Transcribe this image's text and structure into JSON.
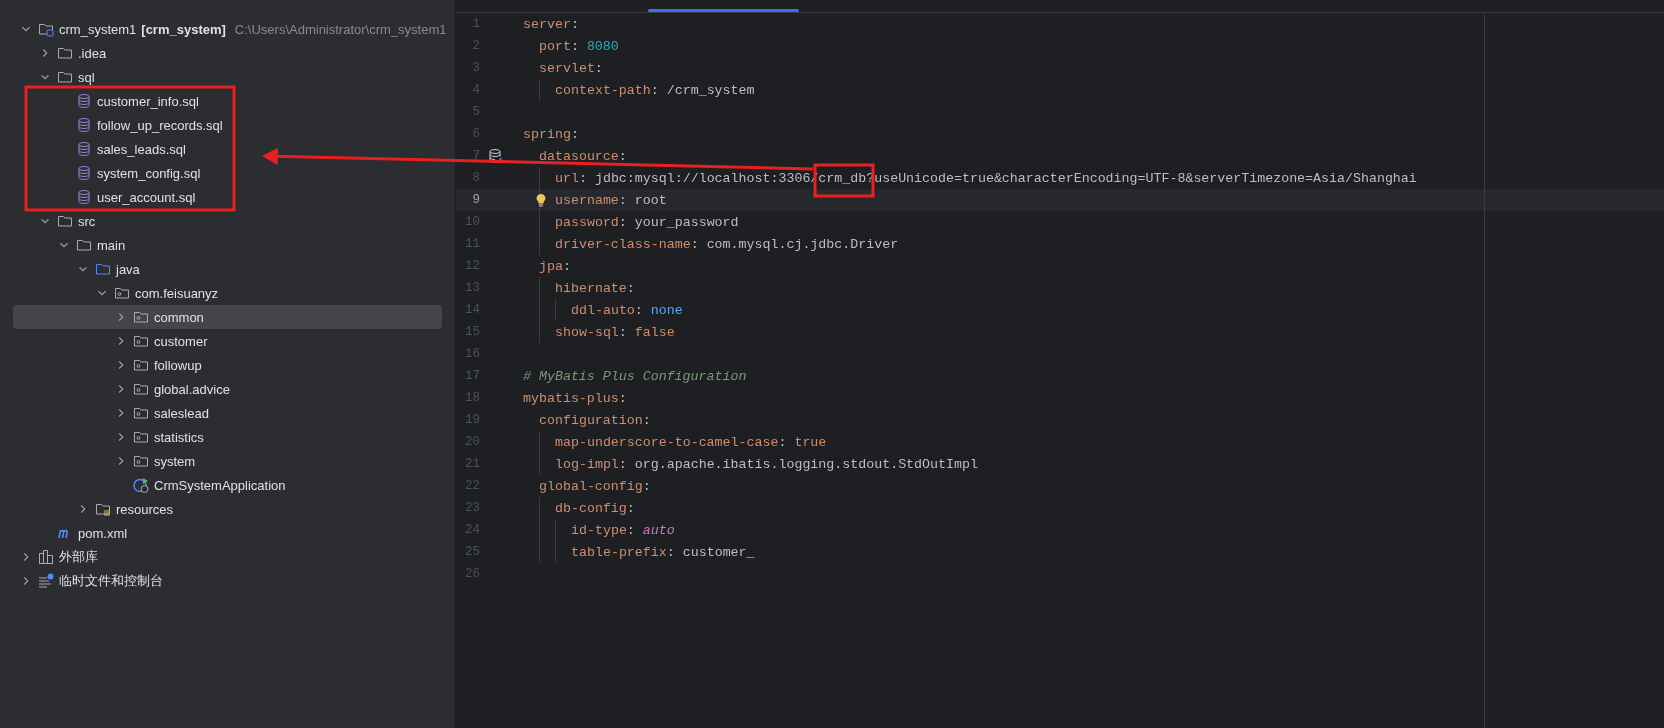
{
  "tree": [
    {
      "kind": "module",
      "label": "crm_system1",
      "module": "[crm_system]",
      "path": "C:\\Users\\Administrator\\crm_system1",
      "expanded": true,
      "selected": false,
      "children": [
        {
          "kind": "folder",
          "label": ".idea",
          "expanded": false,
          "selected": false
        },
        {
          "kind": "folder",
          "label": "sql",
          "expanded": true,
          "selected": false,
          "children": [
            {
              "kind": "sql",
              "label": "customer_info.sql",
              "selected": false
            },
            {
              "kind": "sql",
              "label": "follow_up_records.sql",
              "selected": false
            },
            {
              "kind": "sql",
              "label": "sales_leads.sql",
              "selected": false
            },
            {
              "kind": "sql",
              "label": "system_config.sql",
              "selected": false
            },
            {
              "kind": "sql",
              "label": "user_account.sql",
              "selected": false
            }
          ]
        },
        {
          "kind": "folder",
          "label": "src",
          "expanded": true,
          "selected": false,
          "children": [
            {
              "kind": "folder",
              "label": "main",
              "expanded": true,
              "selected": false,
              "children": [
                {
                  "kind": "source",
                  "label": "java",
                  "expanded": true,
                  "selected": false,
                  "children": [
                    {
                      "kind": "package",
                      "label": "com.feisuanyz",
                      "expanded": true,
                      "selected": false,
                      "children": [
                        {
                          "kind": "package",
                          "label": "common",
                          "expanded": false,
                          "selected": true
                        },
                        {
                          "kind": "package",
                          "label": "customer",
                          "expanded": false,
                          "selected": false
                        },
                        {
                          "kind": "package",
                          "label": "followup",
                          "expanded": false,
                          "selected": false
                        },
                        {
                          "kind": "package",
                          "label": "global.advice",
                          "expanded": false,
                          "selected": false
                        },
                        {
                          "kind": "package",
                          "label": "saleslead",
                          "expanded": false,
                          "selected": false
                        },
                        {
                          "kind": "package",
                          "label": "statistics",
                          "expanded": false,
                          "selected": false
                        },
                        {
                          "kind": "package",
                          "label": "system",
                          "expanded": false,
                          "selected": false
                        },
                        {
                          "kind": "app",
                          "label": "CrmSystemApplication",
                          "selected": false
                        }
                      ]
                    }
                  ]
                },
                {
                  "kind": "resources",
                  "label": "resources",
                  "expanded": false,
                  "selected": false
                }
              ]
            }
          ]
        },
        {
          "kind": "maven",
          "label": "pom.xml",
          "selected": false
        }
      ]
    },
    {
      "kind": "library",
      "label": "外部库",
      "expanded": false,
      "selected": false
    },
    {
      "kind": "scratches",
      "label": "临时文件和控制台",
      "expanded": false,
      "selected": false
    }
  ],
  "editor": {
    "lines": [
      {
        "number": "1",
        "current": false,
        "tokens": [
          {
            "kind": "key",
            "text": "server"
          },
          {
            "kind": "punct",
            "text": ":"
          }
        ]
      },
      {
        "number": "2",
        "current": false,
        "tokens": [
          {
            "kind": "key",
            "text": "  port"
          },
          {
            "kind": "punct",
            "text": ": "
          },
          {
            "kind": "number",
            "text": "8080"
          }
        ]
      },
      {
        "number": "3",
        "current": false,
        "tokens": [
          {
            "kind": "key",
            "text": "  servlet"
          },
          {
            "kind": "punct",
            "text": ":"
          }
        ]
      },
      {
        "number": "4",
        "current": false,
        "tokens": [
          {
            "kind": "key",
            "text": "    context-path"
          },
          {
            "kind": "punct",
            "text": ": "
          },
          {
            "kind": "value",
            "text": "/crm_system"
          }
        ]
      },
      {
        "number": "5",
        "current": false
      },
      {
        "number": "6",
        "current": false,
        "tokens": [
          {
            "kind": "key",
            "text": "spring"
          },
          {
            "kind": "punct",
            "text": ":"
          }
        ]
      },
      {
        "number": "7",
        "current": false,
        "kind": "database",
        "tokens": [
          {
            "kind": "key",
            "text": "  datasource"
          },
          {
            "kind": "punct",
            "text": ":"
          }
        ]
      },
      {
        "number": "8",
        "current": false,
        "tokens": [
          {
            "kind": "key",
            "text": "    url"
          },
          {
            "kind": "punct",
            "text": ": "
          },
          {
            "kind": "value",
            "text": "jdbc:mysql://localhost:3306/crm_db?useUnicode=true&characterEncoding=UTF-8&serverTimezone=Asia/Shanghai"
          }
        ]
      },
      {
        "number": "9",
        "current": true,
        "kind": "bulb",
        "tokens": [
          {
            "kind": "key",
            "text": "    username"
          },
          {
            "kind": "punct",
            "text": ": "
          },
          {
            "kind": "value",
            "text": "root"
          }
        ]
      },
      {
        "number": "10",
        "current": false,
        "tokens": [
          {
            "kind": "key",
            "text": "    password"
          },
          {
            "kind": "punct",
            "text": ": "
          },
          {
            "kind": "value",
            "text": "your_password"
          }
        ]
      },
      {
        "number": "11",
        "current": false,
        "tokens": [
          {
            "kind": "key",
            "text": "    driver-class-name"
          },
          {
            "kind": "punct",
            "text": ": "
          },
          {
            "kind": "value",
            "text": "com.mysql.cj.jdbc.Driver"
          }
        ]
      },
      {
        "number": "12",
        "current": false,
        "tokens": [
          {
            "kind": "key",
            "text": "  jpa"
          },
          {
            "kind": "punct",
            "text": ":"
          }
        ]
      },
      {
        "number": "13",
        "current": false,
        "tokens": [
          {
            "kind": "key",
            "text": "    hibernate"
          },
          {
            "kind": "punct",
            "text": ":"
          }
        ]
      },
      {
        "number": "14",
        "current": false,
        "tokens": [
          {
            "kind": "key",
            "text": "      ddl-auto"
          },
          {
            "kind": "punct",
            "text": ": "
          },
          {
            "kind": "keyword",
            "text": "none"
          }
        ]
      },
      {
        "number": "15",
        "current": false,
        "tokens": [
          {
            "kind": "key",
            "text": "    show-sql"
          },
          {
            "kind": "punct",
            "text": ": "
          },
          {
            "kind": "bool",
            "text": "false"
          }
        ]
      },
      {
        "number": "16",
        "current": false
      },
      {
        "number": "17",
        "current": false,
        "tokens": [
          {
            "kind": "comment",
            "text": "# MyBatis Plus Configuration"
          }
        ]
      },
      {
        "number": "18",
        "current": false,
        "tokens": [
          {
            "kind": "key",
            "text": "mybatis-plus"
          },
          {
            "kind": "punct",
            "text": ":"
          }
        ]
      },
      {
        "number": "19",
        "current": false,
        "tokens": [
          {
            "kind": "key",
            "text": "  configuration"
          },
          {
            "kind": "punct",
            "text": ":"
          }
        ]
      },
      {
        "number": "20",
        "current": false,
        "tokens": [
          {
            "kind": "key",
            "text": "    map-underscore-to-camel-case"
          },
          {
            "kind": "punct",
            "text": ": "
          },
          {
            "kind": "bool",
            "text": "true"
          }
        ]
      },
      {
        "number": "21",
        "current": false,
        "tokens": [
          {
            "kind": "key",
            "text": "    log-impl"
          },
          {
            "kind": "punct",
            "text": ": "
          },
          {
            "kind": "value",
            "text": "org.apache.ibatis.logging.stdout.StdOutImpl"
          }
        ]
      },
      {
        "number": "22",
        "current": false,
        "tokens": [
          {
            "kind": "key",
            "text": "  global-config"
          },
          {
            "kind": "punct",
            "text": ":"
          }
        ]
      },
      {
        "number": "23",
        "current": false,
        "tokens": [
          {
            "kind": "key",
            "text": "    db-config"
          },
          {
            "kind": "punct",
            "text": ":"
          }
        ]
      },
      {
        "number": "24",
        "current": false,
        "tokens": [
          {
            "kind": "key",
            "text": "      id-type"
          },
          {
            "kind": "punct",
            "text": ": "
          },
          {
            "kind": "italic",
            "text": "auto"
          }
        ]
      },
      {
        "number": "25",
        "current": false,
        "tokens": [
          {
            "kind": "key",
            "text": "      table-prefix"
          },
          {
            "kind": "punct",
            "text": ": "
          },
          {
            "kind": "value",
            "text": "customer_"
          }
        ]
      },
      {
        "number": "26",
        "current": false
      }
    ]
  }
}
